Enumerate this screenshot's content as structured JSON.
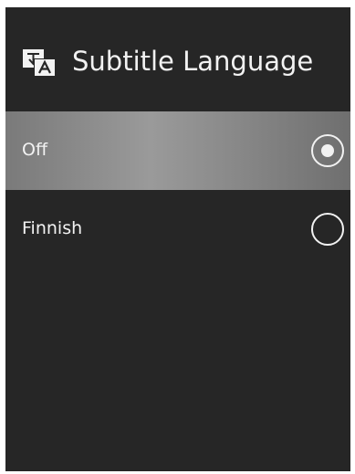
{
  "header": {
    "icon": "subtitle-language-icon",
    "title": "Subtitle Language"
  },
  "options": [
    {
      "label": "Off",
      "selected": true
    },
    {
      "label": "Finnish",
      "selected": false
    }
  ],
  "colors": {
    "background": "#262626",
    "text": "#f2f2f2",
    "selected_row": "#8c8c8c",
    "radio": "#f2f2f2"
  }
}
